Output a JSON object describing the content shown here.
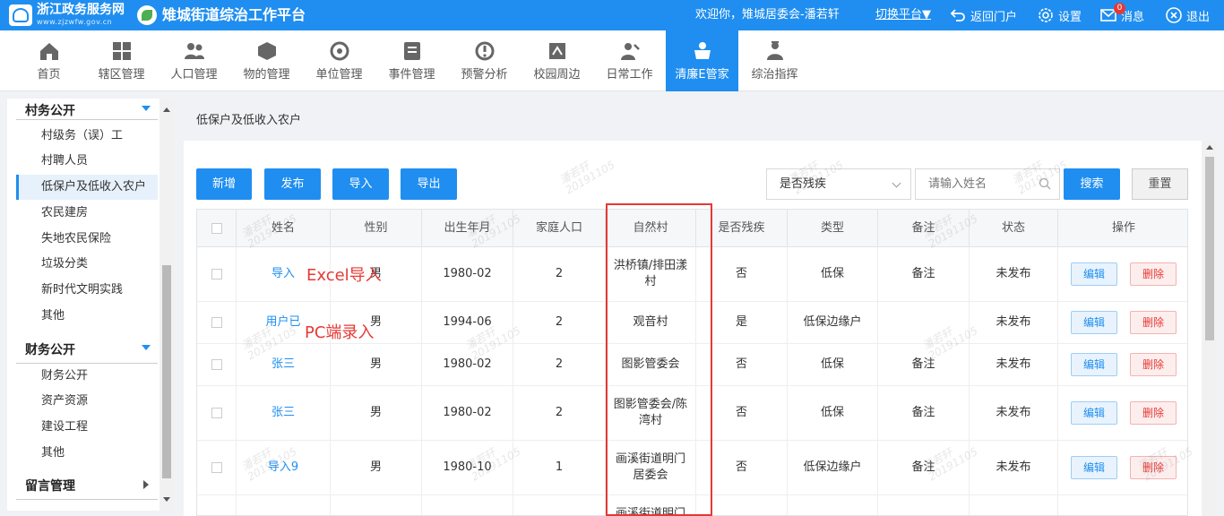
{
  "header": {
    "site_name": "浙江政务服务网",
    "site_sub": "www.zjzwfw.gov.cn",
    "platform_name": "雉城街道综治工作平台",
    "welcome": "欢迎你，雉城居委会-潘若轩",
    "switch_label": "切换平台▼",
    "back_label": "返回门户",
    "settings_label": "设置",
    "message_label": "消息",
    "message_count": "0",
    "logout_label": "退出"
  },
  "nav": [
    {
      "label": "首页",
      "icon": "home-icon"
    },
    {
      "label": "辖区管理",
      "icon": "grid-icon"
    },
    {
      "label": "人口管理",
      "icon": "people-icon"
    },
    {
      "label": "物的管理",
      "icon": "object-icon"
    },
    {
      "label": "单位管理",
      "icon": "unit-icon"
    },
    {
      "label": "事件管理",
      "icon": "event-icon"
    },
    {
      "label": "预警分析",
      "icon": "warning-icon"
    },
    {
      "label": "校园周边",
      "icon": "campus-icon"
    },
    {
      "label": "日常工作",
      "icon": "daily-icon"
    },
    {
      "label": "清廉E管家",
      "icon": "clean-icon",
      "active": true
    },
    {
      "label": "综治指挥",
      "icon": "command-icon"
    }
  ],
  "sidebar": {
    "group1": "村务公开",
    "items1": [
      "村级务（误）工",
      "村聘人员",
      "低保户及低收入农户",
      "农民建房",
      "失地农民保险",
      "垃圾分类",
      "新时代文明实践",
      "其他"
    ],
    "active_index": 2,
    "group2": "财务公开",
    "items2": [
      "财务公开",
      "资产资源",
      "建设工程",
      "其他"
    ],
    "group3": "留言管理"
  },
  "content": {
    "breadcrumb": "低保户及低收入农户",
    "buttons": {
      "add": "新增",
      "publish": "发布",
      "import": "导入",
      "export": "导出",
      "search": "搜索",
      "reset": "重置"
    },
    "filter_select": "是否残疾",
    "search_placeholder": "请输入姓名",
    "annotations": {
      "excel": "Excel导入",
      "pc": "PC端录入"
    },
    "watermark": {
      "name": "潘若轩",
      "date": "20191105"
    }
  },
  "table": {
    "headers": [
      "",
      "姓名",
      "性别",
      "出生年月",
      "家庭人口",
      "自然村",
      "是否残疾",
      "类型",
      "备注",
      "状态",
      "操作"
    ],
    "rows": [
      {
        "name": "导入",
        "gender": "男",
        "birth": "1980-02",
        "family": "2",
        "village": "洪桥镇/排田漾村",
        "disabled": "否",
        "type": "低保",
        "note": "备注",
        "status": "未发布"
      },
      {
        "name": "用户已",
        "gender": "男",
        "birth": "1994-06",
        "family": "2",
        "village": "观音村",
        "disabled": "是",
        "type": "低保边缘户",
        "note": "",
        "status": "未发布"
      },
      {
        "name": "张三",
        "gender": "男",
        "birth": "1980-02",
        "family": "2",
        "village": "图影管委会",
        "disabled": "否",
        "type": "低保",
        "note": "备注",
        "status": "未发布"
      },
      {
        "name": "张三",
        "gender": "男",
        "birth": "1980-02",
        "family": "2",
        "village": "图影管委会/陈湾村",
        "disabled": "否",
        "type": "低保",
        "note": "备注",
        "status": "未发布"
      },
      {
        "name": "导入9",
        "gender": "男",
        "birth": "1980-10",
        "family": "1",
        "village": "画溪街道明门居委会",
        "disabled": "否",
        "type": "低保边缘户",
        "note": "备注",
        "status": "未发布"
      },
      {
        "name": "",
        "gender": "",
        "birth": "",
        "family": "",
        "village": "画溪街道明门",
        "disabled": "",
        "type": "",
        "note": "",
        "status": ""
      }
    ],
    "edit_label": "编辑",
    "delete_label": "删除"
  }
}
